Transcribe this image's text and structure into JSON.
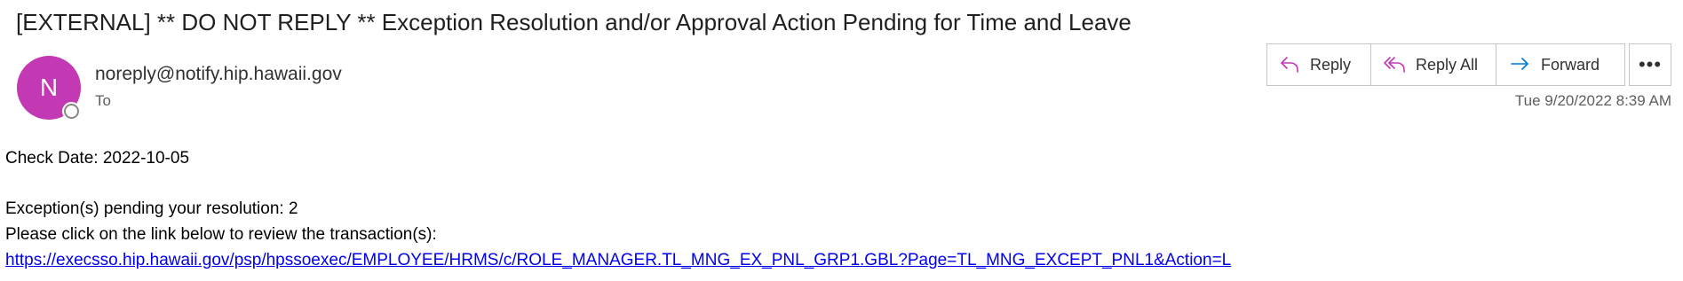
{
  "email": {
    "subject": "[EXTERNAL] ** DO NOT REPLY ** Exception Resolution and/or Approval Action Pending for Time and Leave",
    "sender": "noreply@notify.hip.hawaii.gov",
    "avatar_initial": "N",
    "to_label": "To",
    "timestamp": "Tue 9/20/2022 8:39 AM"
  },
  "actions": {
    "reply_label": "Reply",
    "reply_all_label": "Reply All",
    "forward_label": "Forward",
    "more_label": "•••"
  },
  "body": {
    "check_date": "Check Date: 2022-10-05",
    "exceptions_line": "Exception(s) pending your resolution: 2",
    "instruction_line": "Please click on the link below to review the transaction(s):",
    "link": "https://execsso.hip.hawaii.gov/psp/hpssoexec/EMPLOYEE/HRMS/c/ROLE_MANAGER.TL_MNG_EX_PNL_GRP1.GBL?Page=TL_MNG_EXCEPT_PNL1&Action=L"
  },
  "colors": {
    "avatar_bg": "#c239b3",
    "reply_icon": "#c239b3",
    "forward_icon": "#0078d4",
    "link": "#0000ee"
  },
  "icons": {
    "reply": "reply-icon",
    "reply_all": "reply-all-icon",
    "forward": "forward-icon",
    "more": "more-icon"
  }
}
